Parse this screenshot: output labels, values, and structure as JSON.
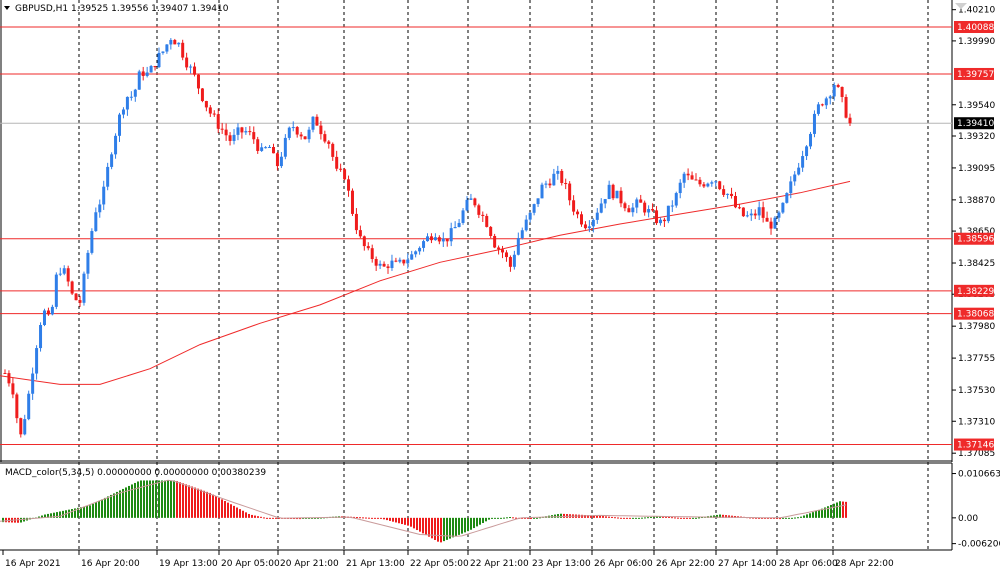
{
  "header": {
    "title": "GBPUSD,H1  1.39525 1.39556 1.39407 1.39410",
    "macd_label": "MACD_color(5,34,5) 0.00000000 0.00000000 0.00380239"
  },
  "colors": {
    "bull": "#2f7ee8",
    "bear": "#ef1c1c",
    "hline": "#ef2a2a",
    "ma": "#ef2a2a",
    "macd_pos": "#1e8a12",
    "macd_neg": "#ef1c1c",
    "macd_signal": "#c99a9a",
    "grid": "#000000",
    "current_price_tag": "#000000"
  },
  "chart_data": [
    {
      "type": "candlestick",
      "symbol": "GBPUSD",
      "timeframe": "H1",
      "ylim": [
        1.3703,
        1.4025
      ],
      "y_ticks": [
        "1.40210",
        "1.39990",
        "1.39540",
        "1.39320",
        "1.39095",
        "1.38870",
        "1.38650",
        "1.38425",
        "1.38205",
        "1.37980",
        "1.37755",
        "1.37530",
        "1.37310",
        "1.37085"
      ],
      "x_ticks": [
        "16 Apr 2021",
        "16 Apr 20:00",
        "19 Apr 13:00",
        "20 Apr 05:00",
        "20 Apr 21:00",
        "21 Apr 13:00",
        "22 Apr 05:00",
        "22 Apr 21:00",
        "23 Apr 13:00",
        "26 Apr 06:00",
        "26 Apr 22:00",
        "27 Apr 14:00",
        "28 Apr 06:00",
        "28 Apr 22:00"
      ],
      "levels": [
        {
          "label": "1.40088",
          "value": 1.40088
        },
        {
          "label": "1.39757",
          "value": 1.39757
        },
        {
          "label": "1.38596",
          "value": 1.38596
        },
        {
          "label": "1.38229",
          "value": 1.38229
        },
        {
          "label": "1.38068",
          "value": 1.38068
        },
        {
          "label": "1.37146",
          "value": 1.37146
        }
      ],
      "current_price": {
        "label": "1.39410",
        "value": 1.3941
      },
      "path": [
        1.3765,
        1.3755,
        1.3718,
        1.3745,
        1.378,
        1.381,
        1.38,
        1.384,
        1.3835,
        1.3818,
        1.3815,
        1.385,
        1.388,
        1.389,
        1.392,
        1.3942,
        1.396,
        1.396,
        1.3978,
        1.3975,
        1.3985,
        1.3992,
        1.4002,
        1.3997,
        1.3985,
        1.3975,
        1.3962,
        1.395,
        1.3942,
        1.3935,
        1.3928,
        1.3935,
        1.3935,
        1.393,
        1.392,
        1.3925,
        1.391,
        1.3925,
        1.394,
        1.3935,
        1.393,
        1.3945,
        1.3935,
        1.3927,
        1.3905,
        1.3905,
        1.388,
        1.386,
        1.385,
        1.3845,
        1.3838,
        1.3843,
        1.384,
        1.3845,
        1.3848,
        1.3855,
        1.386,
        1.3865,
        1.3858,
        1.3862,
        1.387,
        1.3882,
        1.3888,
        1.3878,
        1.387,
        1.3855,
        1.385,
        1.384,
        1.386,
        1.387,
        1.388,
        1.3895,
        1.39,
        1.3905,
        1.39,
        1.3885,
        1.3875,
        1.387,
        1.3875,
        1.3885,
        1.3895,
        1.389,
        1.3885,
        1.388,
        1.3885,
        1.388,
        1.3875,
        1.387,
        1.388,
        1.389,
        1.3905,
        1.39,
        1.3898,
        1.39,
        1.3903,
        1.3895,
        1.389,
        1.388,
        1.3875,
        1.3875,
        1.388,
        1.387,
        1.387,
        1.388,
        1.3895,
        1.391,
        1.3925,
        1.394,
        1.3955,
        1.396,
        1.397,
        1.3955,
        1.3941
      ],
      "ma_points": [
        [
          0,
          1.3763
        ],
        [
          60,
          1.3757
        ],
        [
          100,
          1.3757
        ],
        [
          150,
          1.3768
        ],
        [
          200,
          1.3785
        ],
        [
          260,
          1.38
        ],
        [
          320,
          1.3813
        ],
        [
          380,
          1.383
        ],
        [
          440,
          1.3843
        ],
        [
          500,
          1.3852
        ],
        [
          560,
          1.3862
        ],
        [
          620,
          1.387
        ],
        [
          680,
          1.3877
        ],
        [
          740,
          1.3884
        ],
        [
          800,
          1.3892
        ],
        [
          850,
          1.39
        ]
      ]
    },
    {
      "type": "bar",
      "name": "MACD_color(5,34,5)",
      "ylim": [
        -0.0075,
        0.012
      ],
      "y_ticks": [
        "0.0106638",
        "0.00",
        "-0.0062066"
      ],
      "anchors": [
        [
          0,
          -0.001
        ],
        [
          20,
          -0.0012
        ],
        [
          45,
          0.0008
        ],
        [
          90,
          0.003
        ],
        [
          140,
          0.009
        ],
        [
          175,
          0.009
        ],
        [
          210,
          0.006
        ],
        [
          250,
          0.0008
        ],
        [
          270,
          -0.0002
        ],
        [
          300,
          -0.0003
        ],
        [
          340,
          0.0004
        ],
        [
          380,
          -0.0001
        ],
        [
          410,
          -0.002
        ],
        [
          440,
          -0.006
        ],
        [
          470,
          -0.003
        ],
        [
          490,
          -0.0003
        ],
        [
          510,
          0.0002
        ],
        [
          530,
          -0.0003
        ],
        [
          560,
          0.001
        ],
        [
          600,
          0.0005
        ],
        [
          630,
          -0.0002
        ],
        [
          660,
          0.0004
        ],
        [
          690,
          -0.0002
        ],
        [
          720,
          0.0008
        ],
        [
          750,
          0.0001
        ],
        [
          780,
          -0.0003
        ],
        [
          800,
          0.0002
        ],
        [
          820,
          0.002
        ],
        [
          840,
          0.004
        ],
        [
          848,
          0.0038
        ]
      ],
      "signal_anchors": [
        [
          0,
          -0.0008
        ],
        [
          60,
          0.0004
        ],
        [
          120,
          0.006
        ],
        [
          170,
          0.0092
        ],
        [
          230,
          0.004
        ],
        [
          280,
          -0.0001
        ],
        [
          350,
          0.0002
        ],
        [
          420,
          -0.004
        ],
        [
          460,
          -0.0045
        ],
        [
          520,
          0.0
        ],
        [
          600,
          0.0006
        ],
        [
          700,
          0.0002
        ],
        [
          780,
          0.0
        ],
        [
          848,
          0.0032
        ]
      ]
    }
  ]
}
